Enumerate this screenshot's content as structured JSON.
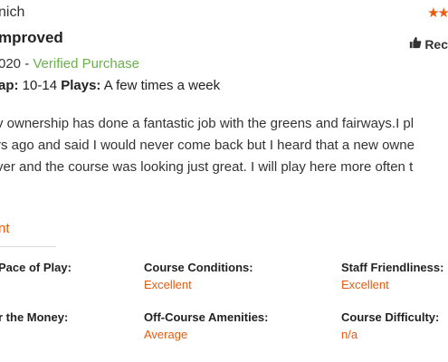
{
  "review": {
    "reviewer": "nich",
    "rating": 2,
    "rating_max": 5,
    "title": "mproved",
    "recommend_label": "Rec",
    "date": "020",
    "date_sep": " - ",
    "verified": "Verified Purchase",
    "handicap_label": "ap:",
    "handicap_value": "10-14",
    "plays_label": "Plays:",
    "plays_value": "A few times a week",
    "body_lines": [
      "v ownership has done a fantastic job with the greens and fairways.I pl",
      "rs ago and said I would never come back but I heard that a new owne",
      "ver and the course was looking just great. I will play here more often t"
    ]
  },
  "ratings_section": {
    "heading": "nt",
    "items": [
      {
        "label": "Pace of Play:",
        "value": ""
      },
      {
        "label": "Course Conditions:",
        "value": "Excellent"
      },
      {
        "label": "Staff Friendliness:",
        "value": "Excellent"
      },
      {
        "label": "r the Money:",
        "value": ""
      },
      {
        "label": "Off-Course Amenities:",
        "value": "Average"
      },
      {
        "label": "Course Difficulty:",
        "value": "n/a"
      }
    ]
  },
  "colors": {
    "accent": "#e8590c",
    "verified": "#6ab04c"
  },
  "icons": {
    "star": "star-icon",
    "recommend": "thumbs-up-icon"
  }
}
